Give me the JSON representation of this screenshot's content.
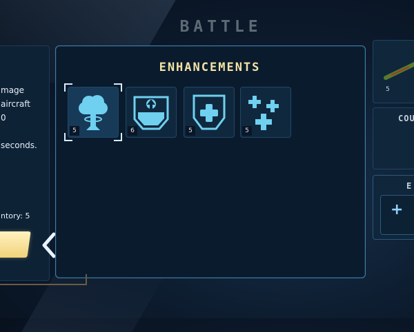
{
  "header": {
    "title": "BATTLE"
  },
  "left_panel": {
    "description": "mage\naircraft\n0\n\nseconds.",
    "inventory": "ntory: 5",
    "back_icon": "chevron-left-icon"
  },
  "enhancements": {
    "title": "ENHANCEMENTS",
    "items": [
      {
        "icon": "mushroom-cloud-icon",
        "count": "5",
        "selected": true
      },
      {
        "icon": "shield-tank-up-icon",
        "count": "6",
        "selected": false
      },
      {
        "icon": "shield-plus-icon",
        "count": "5",
        "selected": false
      },
      {
        "icon": "multi-plus-icon",
        "count": "5",
        "selected": false
      }
    ]
  },
  "right_panel": {
    "card1": {
      "count": "5",
      "icon": "weapon-icon"
    },
    "card2": {
      "label": "COU"
    },
    "card3": {
      "label": "E",
      "add_icon": "plus-icon"
    }
  },
  "colors": {
    "accent_title": "#f4e3a3",
    "icon_cyan": "#6fd0f0",
    "panel_border": "#2a5f86"
  }
}
